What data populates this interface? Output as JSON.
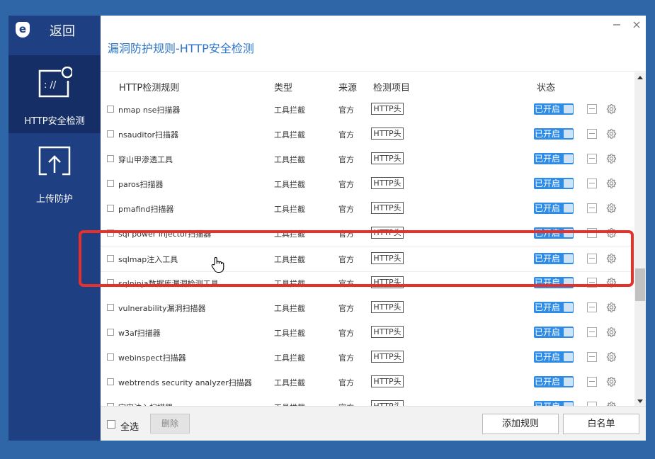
{
  "sidebar": {
    "logo_letter": "e",
    "back_label": "返回",
    "items": [
      {
        "label": "HTTP安全检测",
        "icon": "http-icon",
        "active": true
      },
      {
        "label": "上传防护",
        "icon": "upload-icon",
        "active": false
      }
    ]
  },
  "header": {
    "title": "漏洞防护规则-HTTP安全检测",
    "columns": [
      "HTTP检测规则",
      "类型",
      "来源",
      "检测项目",
      "状态"
    ]
  },
  "rows": [
    {
      "name": "nmap nse扫描器",
      "type": "工具拦截",
      "source": "官方",
      "item": "HTTP头",
      "status": "已开启"
    },
    {
      "name": "nsauditor扫描器",
      "type": "工具拦截",
      "source": "官方",
      "item": "HTTP头",
      "status": "已开启"
    },
    {
      "name": "穿山甲渗透工具",
      "type": "工具拦截",
      "source": "官方",
      "item": "HTTP头",
      "status": "已开启"
    },
    {
      "name": "paros扫描器",
      "type": "工具拦截",
      "source": "官方",
      "item": "HTTP头",
      "status": "已开启"
    },
    {
      "name": "pmafind扫描器",
      "type": "工具拦截",
      "source": "官方",
      "item": "HTTP头",
      "status": "已开启"
    },
    {
      "name": "sql power injector扫描器",
      "type": "工具拦截",
      "source": "官方",
      "item": "HTTP头",
      "status": "已开启"
    },
    {
      "name": "sqlmap注入工具",
      "type": "工具拦截",
      "source": "官方",
      "item": "HTTP头",
      "status": "已开启"
    },
    {
      "name": "sqlninja数据库漏洞检测工具",
      "type": "工具拦截",
      "source": "官方",
      "item": "HTTP头",
      "status": "已开启"
    },
    {
      "name": "vulnerability漏洞扫描器",
      "type": "工具拦截",
      "source": "官方",
      "item": "HTTP头",
      "status": "已开启"
    },
    {
      "name": "w3af扫描器",
      "type": "工具拦截",
      "source": "官方",
      "item": "HTTP头",
      "status": "已开启"
    },
    {
      "name": "webinspect扫描器",
      "type": "工具拦截",
      "source": "官方",
      "item": "HTTP头",
      "status": "已开启"
    },
    {
      "name": "webtrends security analyzer扫描器",
      "type": "工具拦截",
      "source": "官方",
      "item": "HTTP头",
      "status": "已开启"
    },
    {
      "name": "宇宙注入扫描器",
      "type": "工具拦截",
      "source": "官方",
      "item": "HTTP头",
      "status": "已开启"
    }
  ],
  "footer": {
    "select_all": "全选",
    "delete": "删除",
    "add_rule": "添加规则",
    "whitelist": "白名单"
  },
  "colors": {
    "sidebar_bg": "#1e3f82",
    "title_blue": "#2c74c9",
    "toggle_on": "#2f8ce6",
    "highlight_box": "#e8302a"
  }
}
